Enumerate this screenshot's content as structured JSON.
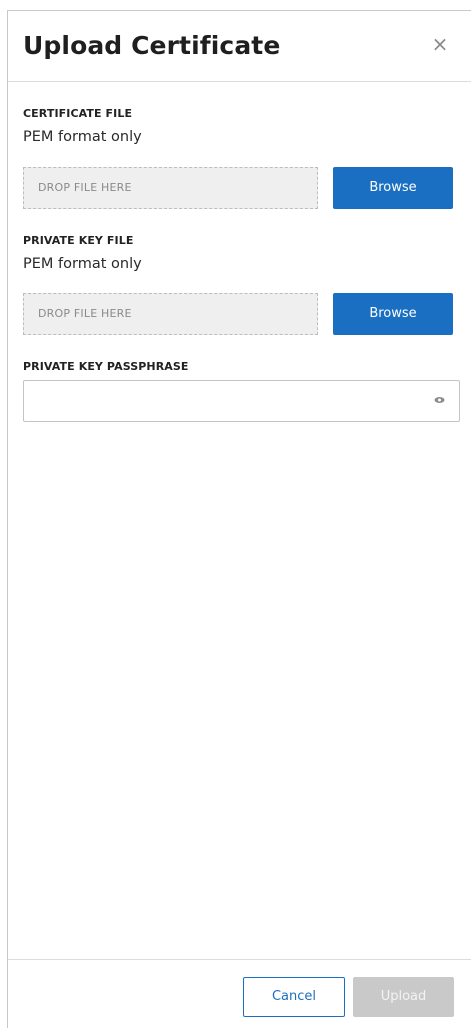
{
  "dialog": {
    "title": "Upload Certificate",
    "close_icon": "close-icon",
    "close_glyph": "×"
  },
  "certificate_file": {
    "label": "CERTIFICATE FILE",
    "subtitle": "PEM format only",
    "drop_text": "DROP FILE HERE",
    "browse_label": "Browse"
  },
  "private_key_file": {
    "label": "PRIVATE KEY FILE",
    "subtitle": "PEM format only",
    "drop_text": "DROP FILE HERE",
    "browse_label": "Browse"
  },
  "passphrase": {
    "label": "PRIVATE KEY PASSPHRASE",
    "value": "",
    "toggle_icon": "eye-icon"
  },
  "footer": {
    "cancel_label": "Cancel",
    "upload_label": "Upload",
    "upload_enabled": false
  },
  "colors": {
    "primary": "#1b6fc2",
    "disabled": "#c9c9c9",
    "dropzone_bg": "#efefef"
  }
}
